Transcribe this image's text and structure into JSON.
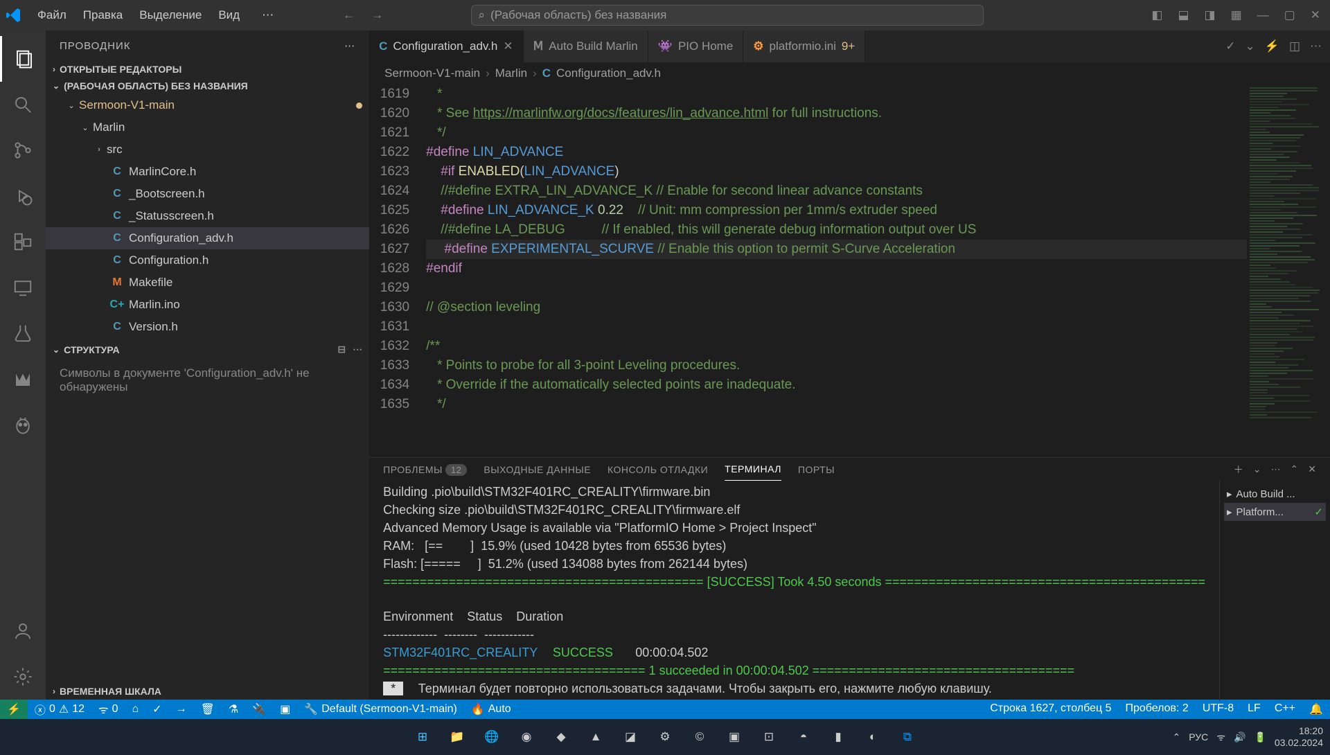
{
  "titlebar": {
    "menu": [
      "Файл",
      "Правка",
      "Выделение",
      "Вид"
    ],
    "search_placeholder": "(Рабочая область) без названия"
  },
  "sidebar": {
    "title": "ПРОВОДНИК",
    "sections": {
      "open_editors": "ОТКРЫТЫЕ РЕДАКТОРЫ",
      "workspace": "(РАБОЧАЯ ОБЛАСТЬ) БЕЗ НАЗВАНИЯ",
      "outline": "СТРУКТУРА",
      "timeline": "ВРЕМЕННАЯ ШКАЛА"
    },
    "root_folder": "Sermoon-V1-main",
    "marlin_folder": "Marlin",
    "src_folder": "src",
    "files": [
      {
        "name": "MarlinCore.h",
        "icon": "C",
        "iconClass": "c"
      },
      {
        "name": "_Bootscreen.h",
        "icon": "C",
        "iconClass": "c"
      },
      {
        "name": "_Statusscreen.h",
        "icon": "C",
        "iconClass": "c"
      },
      {
        "name": "Configuration_adv.h",
        "icon": "C",
        "iconClass": "c",
        "selected": true
      },
      {
        "name": "Configuration.h",
        "icon": "C",
        "iconClass": "c"
      },
      {
        "name": "Makefile",
        "icon": "M",
        "iconClass": "m"
      },
      {
        "name": "Marlin.ino",
        "icon": "C+",
        "iconClass": "ino"
      },
      {
        "name": "Version.h",
        "icon": "C",
        "iconClass": "c"
      }
    ],
    "outline_empty": "Символы в документе 'Configuration_adv.h' не обнаружены"
  },
  "tabs": [
    {
      "icon": "C",
      "iconColor": "#519aba",
      "label": "Configuration_adv.h",
      "active": true,
      "close": true
    },
    {
      "icon": "Ⅿ",
      "iconColor": "#888",
      "label": "Auto Build Marlin",
      "dim": true
    },
    {
      "icon": "👾",
      "iconColor": "#ff9a3c",
      "label": "PIO Home",
      "dim": true
    },
    {
      "icon": "⚙",
      "iconColor": "#ff9a3c",
      "label": "platformio.ini",
      "suffix": "9+",
      "dim": true
    }
  ],
  "breadcrumb": [
    "Sermoon-V1-main",
    "Marlin",
    "Configuration_adv.h"
  ],
  "editor": {
    "lines": [
      1619,
      1620,
      1621,
      1622,
      1623,
      1624,
      1625,
      1626,
      1627,
      1628,
      1629,
      1630,
      1631,
      1632,
      1633,
      1634,
      1635
    ],
    "link_text": "https://marlinfw.org/docs/features/lin_advance.html"
  },
  "panel": {
    "tabs": {
      "problems": "ПРОБЛЕМЫ",
      "problems_badge": "12",
      "output": "ВЫХОДНЫЕ ДАННЫЕ",
      "debug": "КОНСОЛЬ ОТЛАДКИ",
      "terminal": "ТЕРМИНАЛ",
      "ports": "ПОРТЫ"
    },
    "terminal_lines": [
      "Building .pio\\build\\STM32F401RC_CREALITY\\firmware.bin",
      "Checking size .pio\\build\\STM32F401RC_CREALITY\\firmware.elf",
      "Advanced Memory Usage is available via \"PlatformIO Home > Project Inspect\"",
      "RAM:   [==        ]  15.9% (used 10428 bytes from 65536 bytes)",
      "Flash: [=====     ]  51.2% (used 134088 bytes from 262144 bytes)"
    ],
    "success_line_pre": "============================================ [",
    "success_word": "SUCCESS",
    "success_line_post": "] Took 4.50 seconds ============================================",
    "table_header": "Environment    Status    Duration",
    "table_sep": "-------------  --------  ------------",
    "env": "STM32F401RC_CREALITY",
    "env_status": "SUCCESS",
    "env_time": "00:00:04.502",
    "succeeded_line": "==================================== 1 succeeded in 00:00:04.502 ====================================",
    "reuse_msg": "Терминал будет повторно использоваться задачами. Чтобы закрыть его, нажмите любую клавишу.",
    "term_list": [
      {
        "name": "Auto Build ..."
      },
      {
        "name": "Platform...",
        "active": true,
        "check": true
      }
    ]
  },
  "statusbar": {
    "errors": "0",
    "warnings": "12",
    "ports": "0",
    "cmake": "Default (Sermoon-V1-main)",
    "auto": "Auto",
    "cursor": "Строка 1627, столбец 5",
    "spaces": "Пробелов: 2",
    "encoding": "UTF-8",
    "eol": "LF",
    "lang": "C++"
  },
  "taskbar": {
    "lang": "РУС",
    "time": "18:20",
    "date": "03.02.2024"
  }
}
